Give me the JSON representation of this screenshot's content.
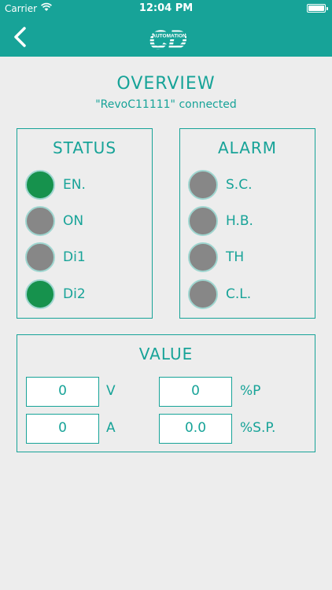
{
  "statusbar": {
    "carrier": "Carrier",
    "time": "12:04 PM"
  },
  "nav": {
    "back_icon": "chevron-left-icon",
    "logo_text": "CD",
    "logo_subtext": "AUTOMATION"
  },
  "header": {
    "title": "OVERVIEW",
    "connection": "\"RevoC11111\" connected"
  },
  "status": {
    "title": "STATUS",
    "items": [
      {
        "label": "EN.",
        "state": "on"
      },
      {
        "label": "ON",
        "state": "off"
      },
      {
        "label": "Di1",
        "state": "off"
      },
      {
        "label": "Di2",
        "state": "on"
      }
    ]
  },
  "alarm": {
    "title": "ALARM",
    "items": [
      {
        "label": "S.C.",
        "state": "off"
      },
      {
        "label": "H.B.",
        "state": "off"
      },
      {
        "label": "TH",
        "state": "off"
      },
      {
        "label": "C.L.",
        "state": "off"
      }
    ]
  },
  "value": {
    "title": "VALUE",
    "voltage": {
      "value": "0",
      "unit": "V"
    },
    "current": {
      "value": "0",
      "unit": "A"
    },
    "power": {
      "value": "0",
      "unit": "%P"
    },
    "setpoint": {
      "value": "0.0",
      "unit": "%S.P."
    }
  },
  "colors": {
    "accent": "#17a398",
    "led_on": "#16924d",
    "led_off": "#878787",
    "background": "#ededed"
  }
}
